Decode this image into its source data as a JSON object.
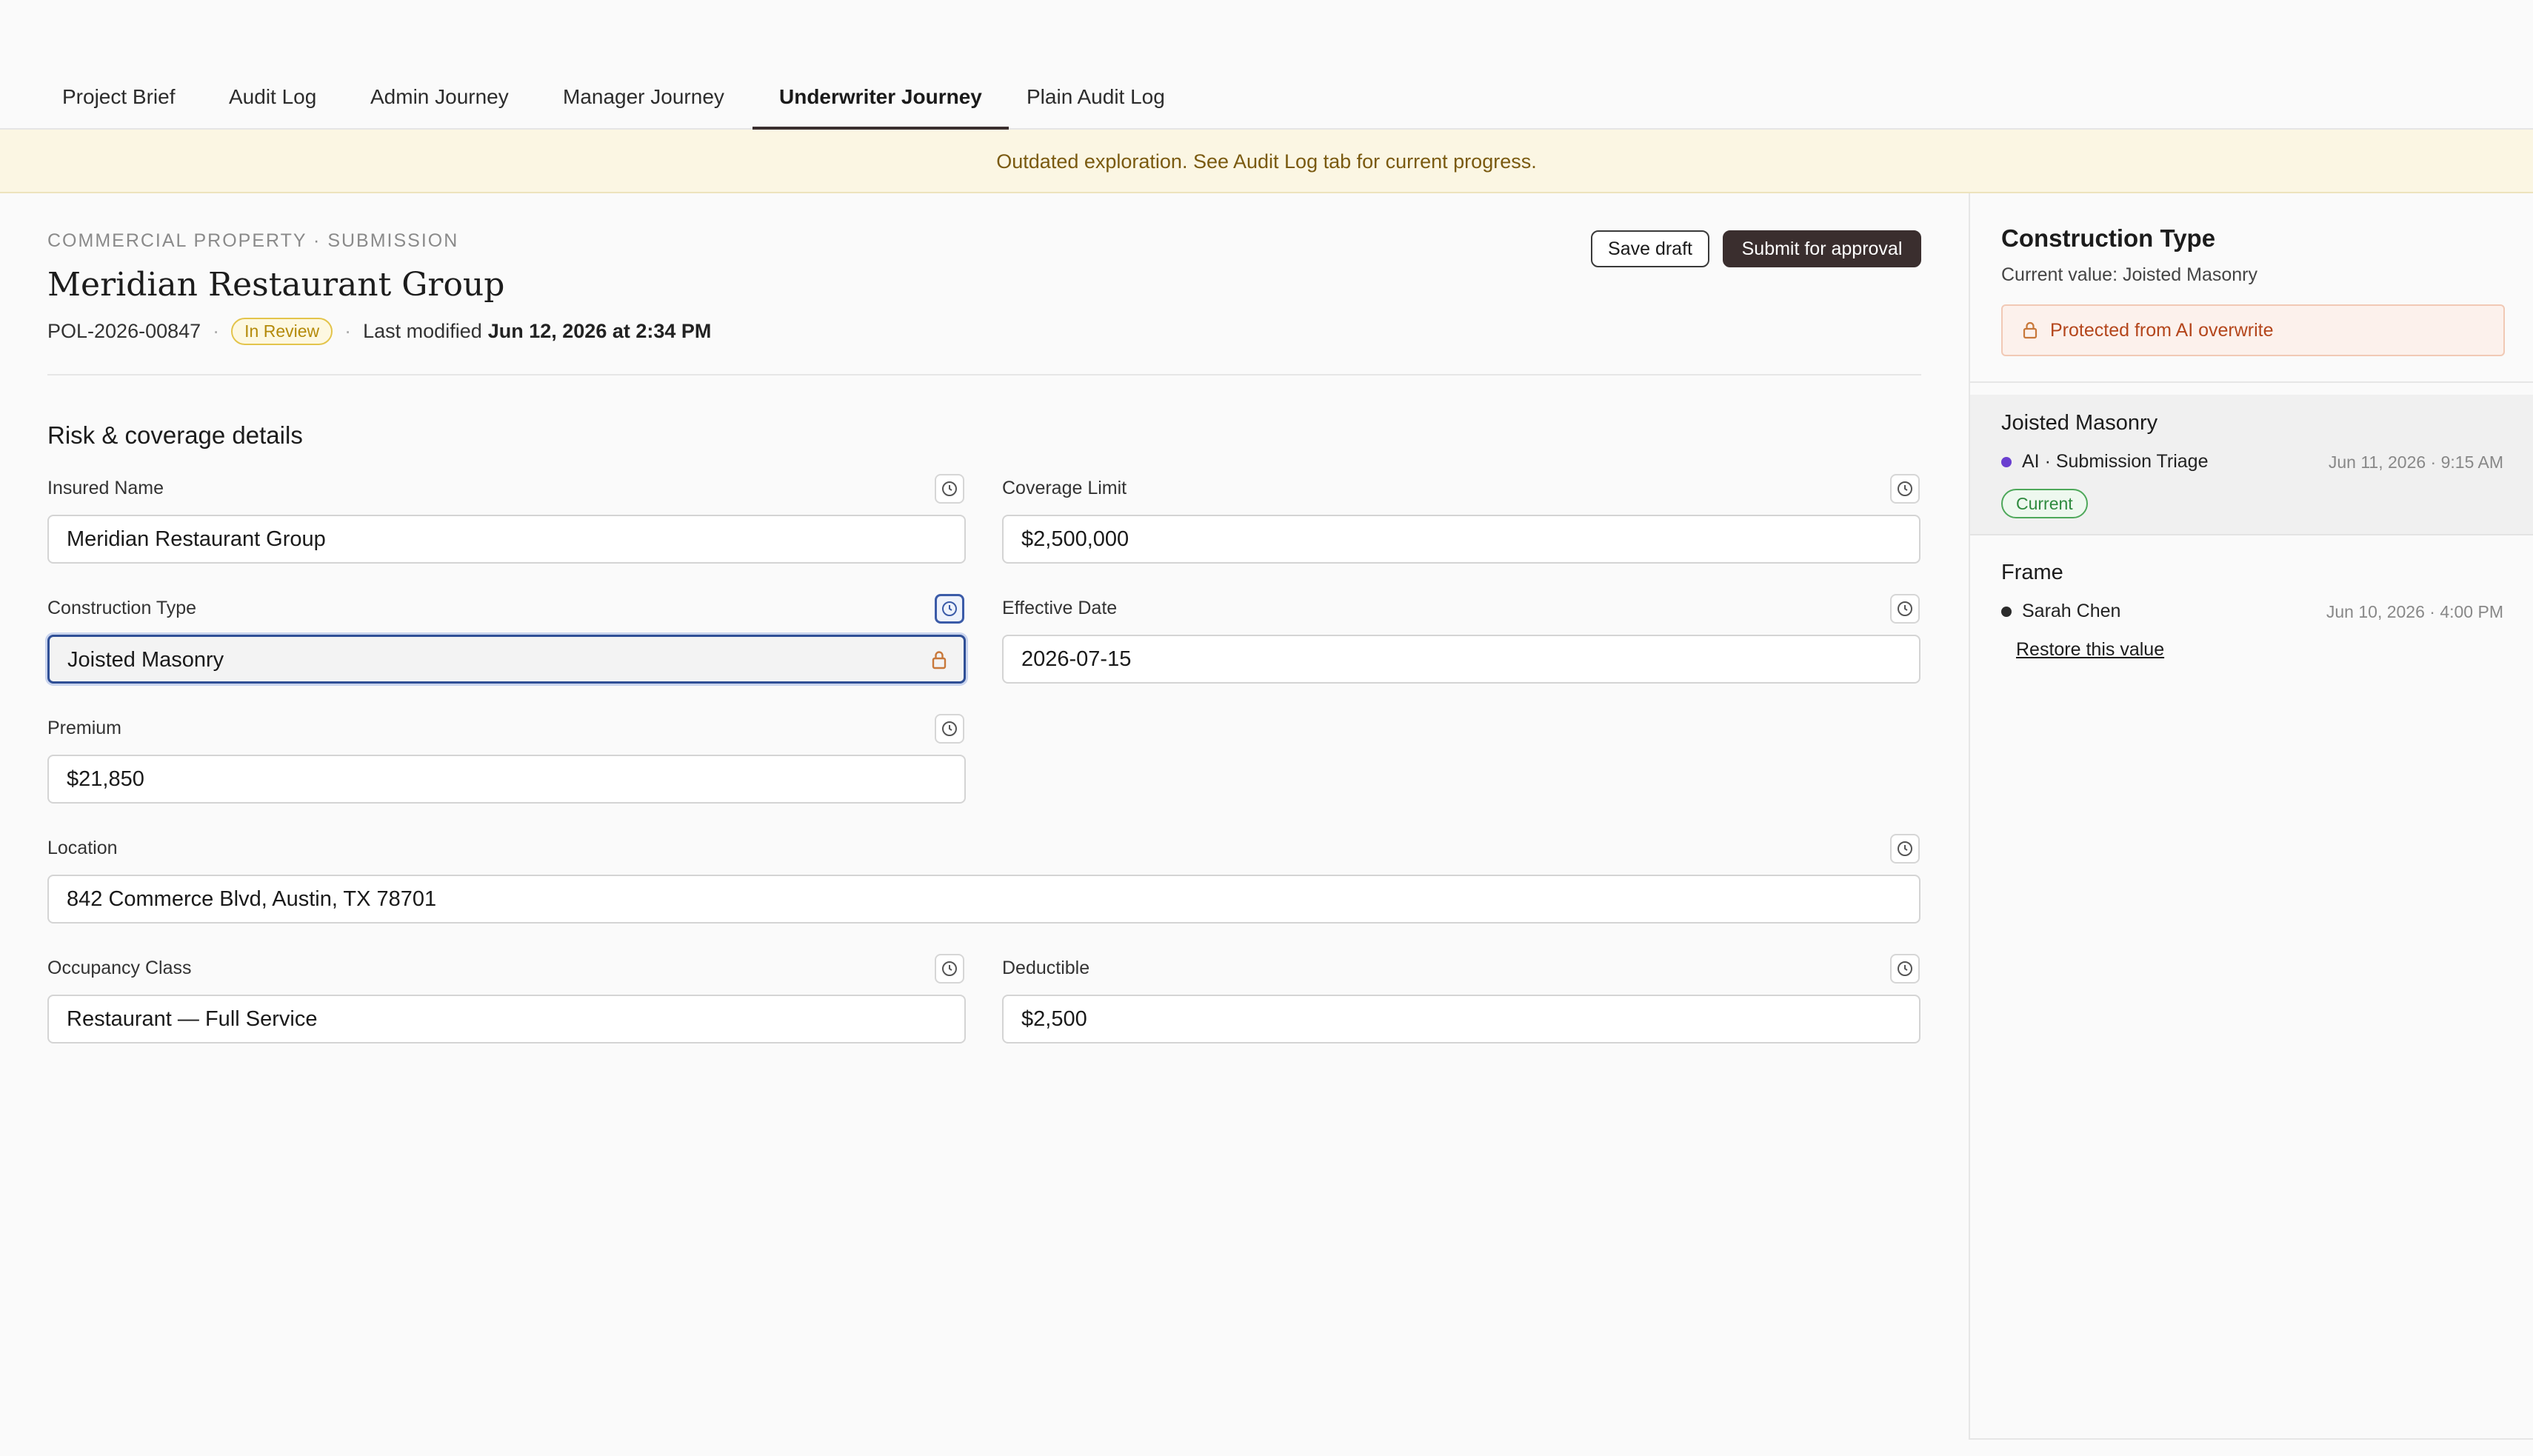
{
  "tabs": [
    {
      "label": "Project Brief",
      "active": false
    },
    {
      "label": "Audit Log",
      "active": false
    },
    {
      "label": "Admin Journey",
      "active": false
    },
    {
      "label": "Manager Journey",
      "active": false
    },
    {
      "label": "Underwriter Journey",
      "active": true
    },
    {
      "label": "Plain Audit Log",
      "active": false
    }
  ],
  "banner": {
    "text": "Outdated exploration. See Audit Log tab for current progress."
  },
  "header": {
    "eyebrow": "COMMERCIAL PROPERTY · SUBMISSION",
    "title": "Meridian Restaurant Group",
    "policy_id": "POL-2026-00847",
    "status": "In Review",
    "modified_label": "Last modified",
    "modified_value": "Jun 12, 2026 at 2:34 PM",
    "save_label": "Save draft",
    "submit_label": "Submit for approval"
  },
  "form": {
    "section_title": "Risk & coverage details",
    "fields": {
      "insured_name": {
        "label": "Insured Name",
        "value": "Meridian Restaurant Group"
      },
      "coverage_limit": {
        "label": "Coverage Limit",
        "value": "$2,500,000"
      },
      "construction_type": {
        "label": "Construction Type",
        "value": "Joisted Masonry"
      },
      "effective_date": {
        "label": "Effective Date",
        "value": "2026-07-15"
      },
      "premium": {
        "label": "Premium",
        "value": "$21,850"
      },
      "location": {
        "label": "Location",
        "value": "842 Commerce Blvd, Austin, TX 78701"
      },
      "occupancy_class": {
        "label": "Occupancy Class",
        "value": "Restaurant — Full Service"
      },
      "deductible": {
        "label": "Deductible",
        "value": "$2,500"
      }
    }
  },
  "panel": {
    "title": "Construction Type",
    "current_value": "Current value: Joisted Masonry",
    "protected_text": "Protected from AI overwrite",
    "history": [
      {
        "value": "Joisted Masonry",
        "source": "AI · Submission Triage",
        "source_color": "#6a3fd0",
        "time": "Jun 11, 2026 · 9:15 AM",
        "badge": "Current"
      },
      {
        "value": "Frame",
        "source": "Sarah Chen",
        "source_color": "#2b2b2b",
        "time": "Jun 10, 2026 · 4:00 PM",
        "action": "Restore this value"
      }
    ]
  },
  "colors": {
    "accent": "#3a2e2e",
    "focus": "#2f4f96",
    "banner_bg": "#fbf6e3",
    "warning_text": "#b4461c"
  }
}
